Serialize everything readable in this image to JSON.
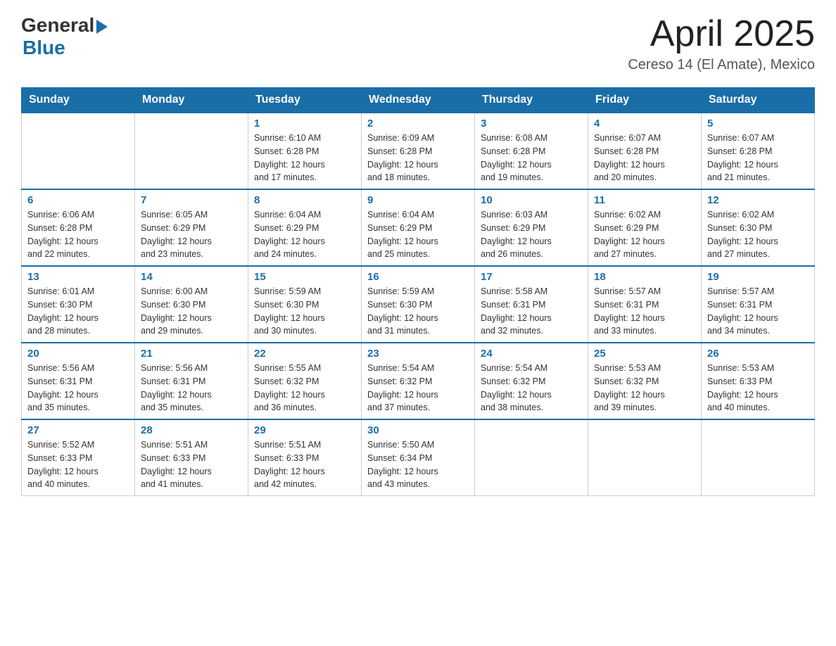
{
  "logo": {
    "general": "General",
    "blue": "Blue"
  },
  "title": "April 2025",
  "subtitle": "Cereso 14 (El Amate), Mexico",
  "headers": [
    "Sunday",
    "Monday",
    "Tuesday",
    "Wednesday",
    "Thursday",
    "Friday",
    "Saturday"
  ],
  "weeks": [
    [
      {
        "day": "",
        "info": ""
      },
      {
        "day": "",
        "info": ""
      },
      {
        "day": "1",
        "info": "Sunrise: 6:10 AM\nSunset: 6:28 PM\nDaylight: 12 hours\nand 17 minutes."
      },
      {
        "day": "2",
        "info": "Sunrise: 6:09 AM\nSunset: 6:28 PM\nDaylight: 12 hours\nand 18 minutes."
      },
      {
        "day": "3",
        "info": "Sunrise: 6:08 AM\nSunset: 6:28 PM\nDaylight: 12 hours\nand 19 minutes."
      },
      {
        "day": "4",
        "info": "Sunrise: 6:07 AM\nSunset: 6:28 PM\nDaylight: 12 hours\nand 20 minutes."
      },
      {
        "day": "5",
        "info": "Sunrise: 6:07 AM\nSunset: 6:28 PM\nDaylight: 12 hours\nand 21 minutes."
      }
    ],
    [
      {
        "day": "6",
        "info": "Sunrise: 6:06 AM\nSunset: 6:28 PM\nDaylight: 12 hours\nand 22 minutes."
      },
      {
        "day": "7",
        "info": "Sunrise: 6:05 AM\nSunset: 6:29 PM\nDaylight: 12 hours\nand 23 minutes."
      },
      {
        "day": "8",
        "info": "Sunrise: 6:04 AM\nSunset: 6:29 PM\nDaylight: 12 hours\nand 24 minutes."
      },
      {
        "day": "9",
        "info": "Sunrise: 6:04 AM\nSunset: 6:29 PM\nDaylight: 12 hours\nand 25 minutes."
      },
      {
        "day": "10",
        "info": "Sunrise: 6:03 AM\nSunset: 6:29 PM\nDaylight: 12 hours\nand 26 minutes."
      },
      {
        "day": "11",
        "info": "Sunrise: 6:02 AM\nSunset: 6:29 PM\nDaylight: 12 hours\nand 27 minutes."
      },
      {
        "day": "12",
        "info": "Sunrise: 6:02 AM\nSunset: 6:30 PM\nDaylight: 12 hours\nand 27 minutes."
      }
    ],
    [
      {
        "day": "13",
        "info": "Sunrise: 6:01 AM\nSunset: 6:30 PM\nDaylight: 12 hours\nand 28 minutes."
      },
      {
        "day": "14",
        "info": "Sunrise: 6:00 AM\nSunset: 6:30 PM\nDaylight: 12 hours\nand 29 minutes."
      },
      {
        "day": "15",
        "info": "Sunrise: 5:59 AM\nSunset: 6:30 PM\nDaylight: 12 hours\nand 30 minutes."
      },
      {
        "day": "16",
        "info": "Sunrise: 5:59 AM\nSunset: 6:30 PM\nDaylight: 12 hours\nand 31 minutes."
      },
      {
        "day": "17",
        "info": "Sunrise: 5:58 AM\nSunset: 6:31 PM\nDaylight: 12 hours\nand 32 minutes."
      },
      {
        "day": "18",
        "info": "Sunrise: 5:57 AM\nSunset: 6:31 PM\nDaylight: 12 hours\nand 33 minutes."
      },
      {
        "day": "19",
        "info": "Sunrise: 5:57 AM\nSunset: 6:31 PM\nDaylight: 12 hours\nand 34 minutes."
      }
    ],
    [
      {
        "day": "20",
        "info": "Sunrise: 5:56 AM\nSunset: 6:31 PM\nDaylight: 12 hours\nand 35 minutes."
      },
      {
        "day": "21",
        "info": "Sunrise: 5:56 AM\nSunset: 6:31 PM\nDaylight: 12 hours\nand 35 minutes."
      },
      {
        "day": "22",
        "info": "Sunrise: 5:55 AM\nSunset: 6:32 PM\nDaylight: 12 hours\nand 36 minutes."
      },
      {
        "day": "23",
        "info": "Sunrise: 5:54 AM\nSunset: 6:32 PM\nDaylight: 12 hours\nand 37 minutes."
      },
      {
        "day": "24",
        "info": "Sunrise: 5:54 AM\nSunset: 6:32 PM\nDaylight: 12 hours\nand 38 minutes."
      },
      {
        "day": "25",
        "info": "Sunrise: 5:53 AM\nSunset: 6:32 PM\nDaylight: 12 hours\nand 39 minutes."
      },
      {
        "day": "26",
        "info": "Sunrise: 5:53 AM\nSunset: 6:33 PM\nDaylight: 12 hours\nand 40 minutes."
      }
    ],
    [
      {
        "day": "27",
        "info": "Sunrise: 5:52 AM\nSunset: 6:33 PM\nDaylight: 12 hours\nand 40 minutes."
      },
      {
        "day": "28",
        "info": "Sunrise: 5:51 AM\nSunset: 6:33 PM\nDaylight: 12 hours\nand 41 minutes."
      },
      {
        "day": "29",
        "info": "Sunrise: 5:51 AM\nSunset: 6:33 PM\nDaylight: 12 hours\nand 42 minutes."
      },
      {
        "day": "30",
        "info": "Sunrise: 5:50 AM\nSunset: 6:34 PM\nDaylight: 12 hours\nand 43 minutes."
      },
      {
        "day": "",
        "info": ""
      },
      {
        "day": "",
        "info": ""
      },
      {
        "day": "",
        "info": ""
      }
    ]
  ]
}
